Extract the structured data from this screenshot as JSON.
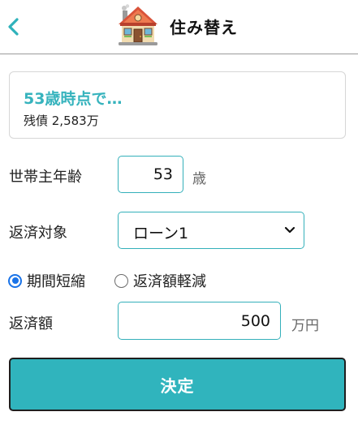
{
  "header": {
    "back_icon": "chevron-left-icon",
    "house_icon": "house-icon",
    "title": "住み替え"
  },
  "info_card": {
    "title": "53歳時点で…",
    "subtitle": "残債 2,583万"
  },
  "form": {
    "age": {
      "label": "世帯主年齢",
      "value": "53",
      "unit": "歳"
    },
    "target": {
      "label": "返済対象",
      "selected": "ローン1"
    },
    "mode": {
      "options": [
        {
          "label": "期間短縮",
          "checked": true
        },
        {
          "label": "返済額軽減",
          "checked": false
        }
      ]
    },
    "amount": {
      "label": "返済額",
      "value": "500",
      "unit": "万円"
    }
  },
  "submit_label": "決定",
  "colors": {
    "accent": "#30b4bd",
    "title_teal": "#36b3bd",
    "radio_blue": "#1a73e8"
  }
}
